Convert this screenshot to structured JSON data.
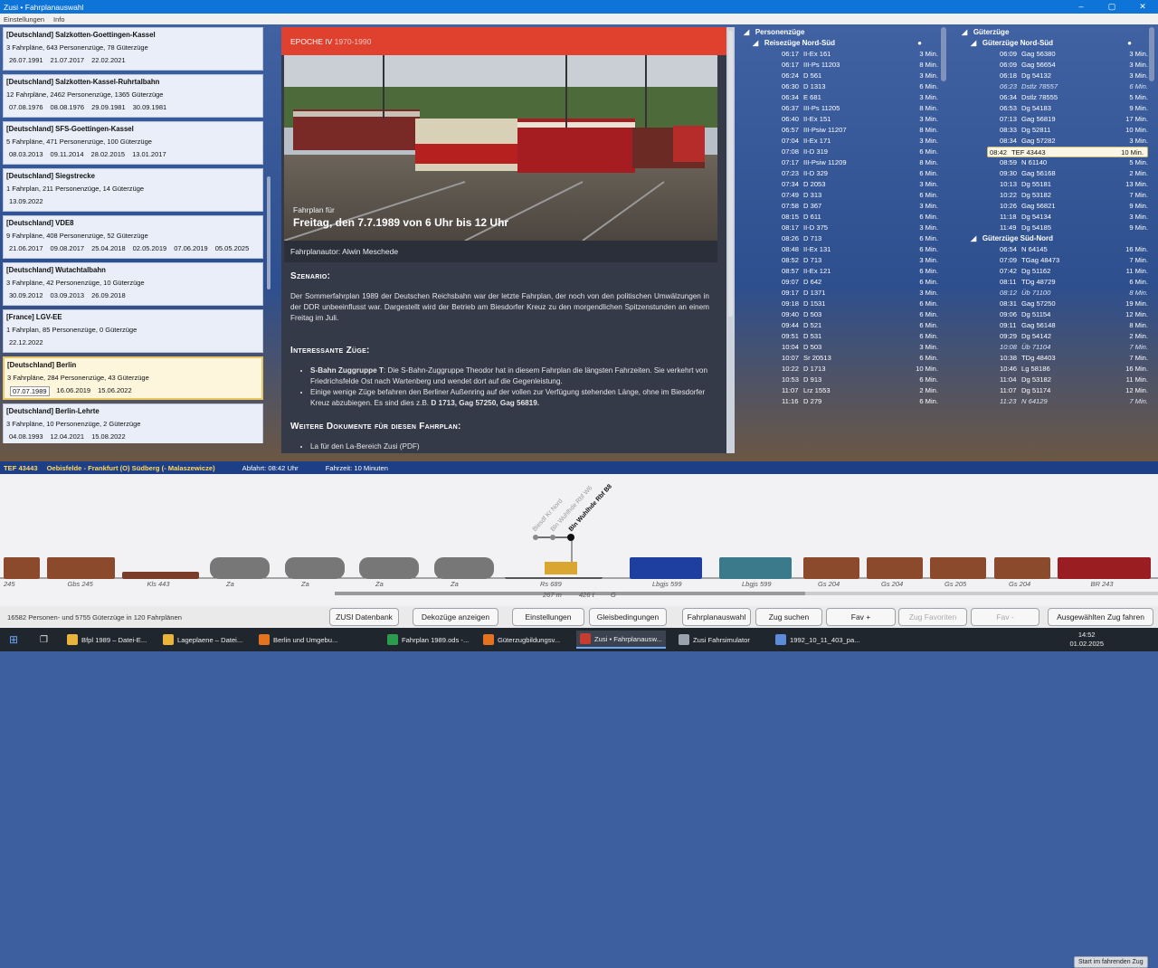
{
  "window": {
    "title": "Zusi • Fahrplanauswahl",
    "min": "–",
    "max": "▢",
    "close": "✕"
  },
  "menu": [
    "Einstellungen",
    "Info"
  ],
  "routes": [
    {
      "name": "[Deutschland] Salzkotten-Goettingen-Kassel",
      "stats": "3 Fahrpläne, 643 Personenzüge, 78 Güterzüge",
      "dates": [
        "26.07.1991",
        "21.07.2017",
        "22.02.2021"
      ]
    },
    {
      "name": "[Deutschland] Salzkotten-Kassel-Ruhrtalbahn",
      "stats": "12 Fahrpläne, 2462 Personenzüge, 1365 Güterzüge",
      "dates": [
        "07.08.1976",
        "08.08.1976",
        "29.09.1981",
        "30.09.1981"
      ]
    },
    {
      "name": "[Deutschland] SFS-Goettingen-Kassel",
      "stats": "5 Fahrpläne, 471 Personenzüge, 100 Güterzüge",
      "dates": [
        "08.03.2013",
        "09.11.2014",
        "28.02.2015",
        "13.01.2017"
      ]
    },
    {
      "name": "[Deutschland] Siegstrecke",
      "stats": "1 Fahrplan, 211 Personenzüge, 14 Güterzüge",
      "dates": [
        "13.09.2022"
      ]
    },
    {
      "name": "[Deutschland] VDE8",
      "stats": "9 Fahrpläne, 408 Personenzüge, 52 Güterzüge",
      "dates": [
        "21.06.2017",
        "09.08.2017",
        "25.04.2018",
        "02.05.2019",
        "07.06.2019",
        "05.05.2025"
      ]
    },
    {
      "name": "[Deutschland] Wutachtalbahn",
      "stats": "3 Fahrpläne, 42 Personenzüge, 10 Güterzüge",
      "dates": [
        "30.09.2012",
        "03.09.2013",
        "26.09.2018"
      ]
    },
    {
      "name": "[France] LGV-EE",
      "stats": "1 Fahrplan, 85 Personenzüge, 0 Güterzüge",
      "dates": [
        "22.12.2022"
      ]
    },
    {
      "name": "[Deutschland] Berlin",
      "stats": "3 Fahrpläne, 284 Personenzüge, 43 Güterzüge",
      "dates": [
        "07.07.1989",
        "16.06.2019",
        "15.06.2022"
      ]
    },
    {
      "name": "[Deutschland] Berlin-Lehrte",
      "stats": "3 Fahrpläne, 10 Personenzüge, 2 Güterzüge",
      "dates": [
        "04.08.1993",
        "12.04.2021",
        "15.08.2022"
      ]
    }
  ],
  "epoch": {
    "label": "EPOCHE IV",
    "years": "1970-1990"
  },
  "timetable": {
    "for": "Fahrplan für",
    "title": "Freitag, den 7.7.1989 von 6 Uhr bis 12 Uhr",
    "author": "Fahrplanautor: Alwin Meschede",
    "scenario_h": "Szenario:",
    "scenario": "Der Sommerfahrplan 1989 der Deutschen Reichsbahn war der letzte Fahrplan, der noch von den politischen Umwälzungen in der DDR unbeeinflusst war. Dargestellt wird der Betrieb am Biesdorfer Kreuz zu den morgendlichen Spitzenstunden an einem Freitag im Juli.",
    "trains_h": "Interessante Züge:",
    "b1_bold": "S-Bahn Zuggruppe T",
    "b1": ": Die S-Bahn-Zuggruppe Theodor hat in diesem Fahrplan die längsten Fahrzeiten. Sie verkehrt von Friedrichsfelde Ost nach Wartenberg und wendet dort auf die Gegenleistung.",
    "b2": "Einige wenige Züge befahren den Berliner Außenring auf der vollen zur Verfügung stehenden Länge, ohne im Biesdorfer Kreuz abzubiegen. Es sind dies z.B. ",
    "b2_bold": "D 1713, Gag 57250, Gag 56819.",
    "docs_h": "Weitere Dokumente für diesen Fahrplan:",
    "docs_item": "La für den La-Bereich Zusi (PDF)"
  },
  "personen": {
    "header": "Personenzüge",
    "sub": "Reisezüge Nord-Süd",
    "rows": [
      [
        "06:17",
        "II-Ex 161",
        "3 Min."
      ],
      [
        "06:17",
        "III-Ps 11203",
        "8 Min."
      ],
      [
        "06:24",
        "D 561",
        "3 Min."
      ],
      [
        "06:30",
        "D 1313",
        "6 Min."
      ],
      [
        "06:34",
        "E 681",
        "3 Min."
      ],
      [
        "06:37",
        "III-Ps 11205",
        "8 Min."
      ],
      [
        "06:40",
        "II-Ex 151",
        "3 Min."
      ],
      [
        "06:57",
        "III-Psiw 11207",
        "8 Min."
      ],
      [
        "07:04",
        "II-Ex 171",
        "3 Min."
      ],
      [
        "07:08",
        "II-D 319",
        "6 Min."
      ],
      [
        "07:17",
        "III-Psiw 11209",
        "8 Min."
      ],
      [
        "07:23",
        "II-D 329",
        "6 Min."
      ],
      [
        "07:34",
        "D 2053",
        "3 Min."
      ],
      [
        "07:49",
        "D 313",
        "6 Min."
      ],
      [
        "07:58",
        "D 367",
        "3 Min."
      ],
      [
        "08:15",
        "D 611",
        "6 Min."
      ],
      [
        "08:17",
        "II-D 375",
        "3 Min."
      ],
      [
        "08:26",
        "D 713",
        "6 Min."
      ],
      [
        "08:48",
        "II-Ex 131",
        "6 Min."
      ],
      [
        "08:52",
        "D 713",
        "3 Min."
      ],
      [
        "08:57",
        "II-Ex 121",
        "6 Min."
      ],
      [
        "09:07",
        "D 642",
        "6 Min."
      ],
      [
        "09:17",
        "D 1371",
        "3 Min."
      ],
      [
        "09:18",
        "D 1531",
        "6 Min."
      ],
      [
        "09:40",
        "D 503",
        "6 Min."
      ],
      [
        "09:44",
        "D 521",
        "6 Min."
      ],
      [
        "09:51",
        "D 531",
        "6 Min."
      ],
      [
        "10:04",
        "D 503",
        "3 Min."
      ],
      [
        "10:07",
        "Sr 20513",
        "6 Min."
      ],
      [
        "10:22",
        "D 1713",
        "10 Min."
      ],
      [
        "10:53",
        "D 913",
        "6 Min."
      ],
      [
        "11:07",
        "Lrz 1553",
        "2 Min."
      ],
      [
        "11:16",
        "D 279",
        "6 Min."
      ]
    ]
  },
  "gueter": {
    "header": "Güterzüge",
    "sub1": "Güterzüge Nord-Süd",
    "sub2": "Güterzüge Süd-Nord",
    "rows1": [
      [
        "06:09",
        "Gag 56380",
        "3 Min.",
        ""
      ],
      [
        "06:09",
        "Gag 56654",
        "3 Min.",
        ""
      ],
      [
        "06:18",
        "Dg 54132",
        "3 Min.",
        ""
      ],
      [
        "06:23",
        "Dstlz 78557",
        "6 Min.",
        "it"
      ],
      [
        "06:34",
        "Dstlz 78555",
        "5 Min.",
        ""
      ],
      [
        "06:53",
        "Dg 54183",
        "9 Min.",
        ""
      ],
      [
        "07:13",
        "Gag 56819",
        "17 Min.",
        ""
      ],
      [
        "08:33",
        "Dg 52811",
        "10 Min.",
        ""
      ],
      [
        "08:34",
        "Gag 57282",
        "3 Min.",
        ""
      ],
      [
        "08:42",
        "TEF 43443",
        "10 Min.",
        "hl"
      ],
      [
        "08:59",
        "N 61140",
        "5 Min.",
        ""
      ],
      [
        "09:30",
        "Gag 56168",
        "2 Min.",
        ""
      ],
      [
        "10:13",
        "Dg 55181",
        "13 Min.",
        ""
      ],
      [
        "10:22",
        "Dg 53182",
        "7 Min.",
        ""
      ],
      [
        "10:26",
        "Gag 56821",
        "9 Min.",
        ""
      ],
      [
        "11:18",
        "Dg 54134",
        "3 Min.",
        ""
      ],
      [
        "11:49",
        "Dg 54185",
        "9 Min.",
        ""
      ]
    ],
    "rows2": [
      [
        "06:54",
        "N 64145",
        "16 Min.",
        ""
      ],
      [
        "07:09",
        "TGag 48473",
        "7 Min.",
        ""
      ],
      [
        "07:42",
        "Dg 51162",
        "11 Min.",
        ""
      ],
      [
        "08:11",
        "TDg 48729",
        "6 Min.",
        ""
      ],
      [
        "08:12",
        "Üb 71100",
        "8 Min.",
        "it"
      ],
      [
        "08:31",
        "Gag 57250",
        "19 Min.",
        ""
      ],
      [
        "09:06",
        "Dg 51154",
        "12 Min.",
        ""
      ],
      [
        "09:11",
        "Gag 56148",
        "8 Min.",
        ""
      ],
      [
        "09:29",
        "Dg 54142",
        "2 Min.",
        ""
      ],
      [
        "10:08",
        "Üb 71104",
        "7 Min.",
        "it"
      ],
      [
        "10:38",
        "TDg 48403",
        "7 Min.",
        ""
      ],
      [
        "10:46",
        "Lg 58186",
        "16 Min.",
        ""
      ],
      [
        "11:04",
        "Dg 53182",
        "11 Min.",
        ""
      ],
      [
        "11:07",
        "Dg 51174",
        "12 Min.",
        ""
      ],
      [
        "11:23",
        "N 64129",
        "7 Min.",
        "it"
      ]
    ]
  },
  "selected": {
    "train": "TEF 43443",
    "route": "Oebisfelde - Frankfurt (O) Südberg (- Malaszewicze)",
    "departure": "Abfahrt: 08:42 Uhr",
    "duration": "Fahrzeit: 10 Minuten"
  },
  "consist": {
    "start_btn": "Start im fahrenden Zug",
    "signals": [
      "Biesdf Kr Nord",
      "Bln Wuhlhde Rbf W6",
      "Bln Wuhlhde Rbf B8"
    ],
    "wagons": [
      "245",
      "Gbs 245",
      "Kls 443",
      "Za",
      "Za",
      "Za",
      "Za",
      "Rs 689",
      "Lbgjs 599",
      "Lbgjs 599",
      "Gs 204",
      "Gs 204",
      "Gs 205",
      "Gs 204",
      "BR 243"
    ],
    "length": "267 m",
    "weight": "426 t",
    "brake": "G"
  },
  "status": "16582 Personen- und 5755 Güterzüge in 120 Fahrplänen",
  "buttons": [
    "ZUSI Datenbank",
    "Dekozüge anzeigen",
    "Einstellungen",
    "Gleisbedingungen",
    "Fahrplanauswahl",
    "Zug suchen",
    "Fav +",
    "Zug Favoriten",
    "Fav -",
    "Ausgewählten Zug fahren"
  ],
  "taskbar": {
    "items": [
      "Bfpl 1989 – Datei-E...",
      "Lageplaene – Datei...",
      "Berlin und Umgebu...",
      "Fahrplan 1989.ods -...",
      "Güterzugbildungsv...",
      "Zusi • Fahrplanausw...",
      "Zusi Fahrsimulator",
      "1992_10_11_403_pa..."
    ],
    "time": "14:52",
    "date": "01.02.2025"
  }
}
